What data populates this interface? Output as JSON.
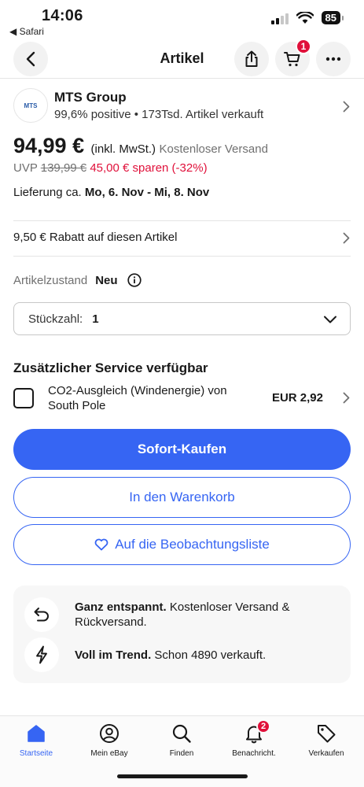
{
  "status_bar": {
    "time": "14:06",
    "back_app": "◀ Safari",
    "battery": "85"
  },
  "nav": {
    "title": "Artikel",
    "cart_count": "1"
  },
  "seller": {
    "logo_text": "MTS",
    "name": "MTS Group",
    "stats": "99,6% positive • 173Tsd. Artikel verkauft"
  },
  "price": {
    "amount": "94,99 €",
    "vat": "(inkl. MwSt.)",
    "shipping": "Kostenloser Versand",
    "uvp_label": "UVP",
    "uvp_old": "139,99 €",
    "savings": "45,00 € sparen (-32%)"
  },
  "delivery": {
    "label": "Lieferung ca.",
    "range": "Mo, 6. Nov - Mi, 8. Nov"
  },
  "discount": {
    "text": "9,50 € Rabatt auf diesen Artikel"
  },
  "condition": {
    "label": "Artikelzustand",
    "value": "Neu"
  },
  "quantity": {
    "label": "Stückzahl:",
    "value": "1"
  },
  "service": {
    "title": "Zusätzlicher Service verfügbar",
    "option_label": "CO2-Ausgleich (Windenergie) von South Pole",
    "option_price": "EUR 2,92",
    "checked": false
  },
  "buttons": {
    "buy_now": "Sofort-Kaufen",
    "add_to_cart": "In den Warenkorb",
    "watchlist": "Auf die Beobachtungsliste"
  },
  "highlights": [
    {
      "icon": "return-icon",
      "bold": "Ganz entspannt.",
      "text": " Kostenloser Versand & Rückversand."
    },
    {
      "icon": "lightning-icon",
      "bold": "Voll im Trend.",
      "text": " Schon 4890 verkauft."
    }
  ],
  "tabs": [
    {
      "label": "Startseite",
      "icon": "home-icon",
      "active": true
    },
    {
      "label": "Mein eBay",
      "icon": "user-icon"
    },
    {
      "label": "Finden",
      "icon": "search-icon"
    },
    {
      "label": "Benachricht.",
      "icon": "bell-icon",
      "badge": "2"
    },
    {
      "label": "Verkaufen",
      "icon": "tag-icon"
    }
  ],
  "colors": {
    "accent": "#3665f3",
    "sale": "#e0103a",
    "muted": "#707070"
  }
}
